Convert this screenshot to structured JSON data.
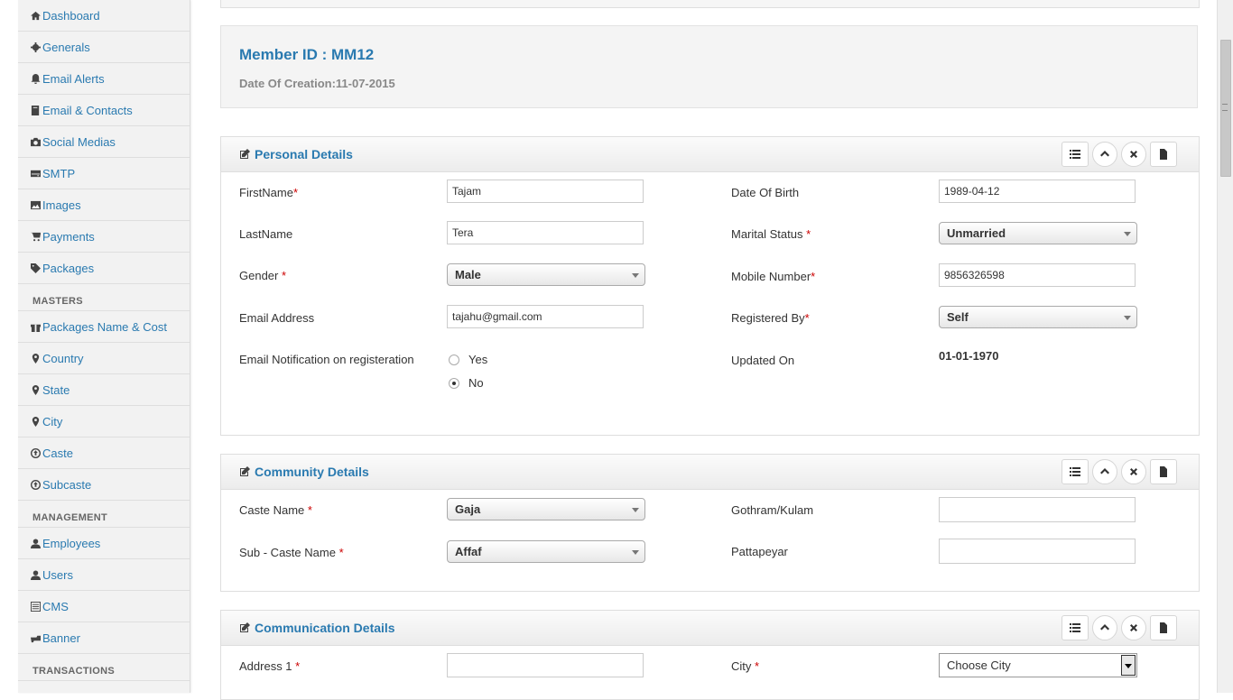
{
  "sidebar": {
    "items": [
      {
        "label": "Dashboard",
        "icon": "home-icon"
      },
      {
        "label": "Generals",
        "icon": "gear-icon"
      },
      {
        "label": "Email Alerts",
        "icon": "bell-icon"
      },
      {
        "label": "Email & Contacts",
        "icon": "book-icon"
      },
      {
        "label": "Social Medias",
        "icon": "camera-icon"
      },
      {
        "label": "SMTP",
        "icon": "hdd-icon"
      },
      {
        "label": "Images",
        "icon": "picture-icon"
      },
      {
        "label": "Payments",
        "icon": "cart-icon"
      },
      {
        "label": "Packages",
        "icon": "tag-icon"
      }
    ],
    "masters_heading": "MASTERS",
    "masters": [
      {
        "label": "Packages Name & Cost",
        "icon": "gift-icon"
      },
      {
        "label": "Country",
        "icon": "map-marker-icon"
      },
      {
        "label": "State",
        "icon": "map-marker-icon"
      },
      {
        "label": "City",
        "icon": "map-marker-icon"
      },
      {
        "label": "Caste",
        "icon": "circle-arrow-icon"
      },
      {
        "label": "Subcaste",
        "icon": "circle-arrow-icon"
      }
    ],
    "management_heading": "MANAGEMENT",
    "management": [
      {
        "label": "Employees",
        "icon": "user-icon"
      },
      {
        "label": "Users",
        "icon": "user-icon"
      },
      {
        "label": "CMS",
        "icon": "list-alt-icon"
      },
      {
        "label": "Banner",
        "icon": "hand-icon"
      }
    ],
    "transactions_heading": "TRANSACTIONS"
  },
  "member": {
    "id_text": "Member ID : MM12",
    "created_text": "Date Of Creation:11-07-2015"
  },
  "personal": {
    "title": "Personal Details",
    "firstname_label": "FirstName",
    "firstname_value": "Tajam",
    "lastname_label": "LastName",
    "lastname_value": "Tera",
    "gender_label": "Gender",
    "gender_value": "Male",
    "email_label": "Email Address",
    "email_value": "tajahu@gmail.com",
    "notify_label": "Email Notification on registeration",
    "notify_yes": "Yes",
    "notify_no": "No",
    "notify_selected": "No",
    "dob_label": "Date Of Birth",
    "dob_value": "1989-04-12",
    "marital_label": "Marital Status",
    "marital_value": "Unmarried",
    "mobile_label": "Mobile Number",
    "mobile_value": "9856326598",
    "registered_label": "Registered By",
    "registered_value": "Self",
    "updated_label": "Updated On",
    "updated_value": "01-01-1970"
  },
  "community": {
    "title": "Community Details",
    "caste_label": "Caste Name",
    "caste_value": "Gaja",
    "subcaste_label": "Sub - Caste Name",
    "subcaste_value": "Affaf",
    "gothram_label": "Gothram/Kulam",
    "gothram_value": "",
    "pattapeyar_label": "Pattapeyar",
    "pattapeyar_value": ""
  },
  "communication": {
    "title": "Communication Details",
    "address1_label": "Address 1",
    "address1_value": "",
    "city_label": "City",
    "city_value": "Choose City"
  },
  "required_mark": "*",
  "colors": {
    "link": "#2a7ab0",
    "required": "#cc0000"
  }
}
